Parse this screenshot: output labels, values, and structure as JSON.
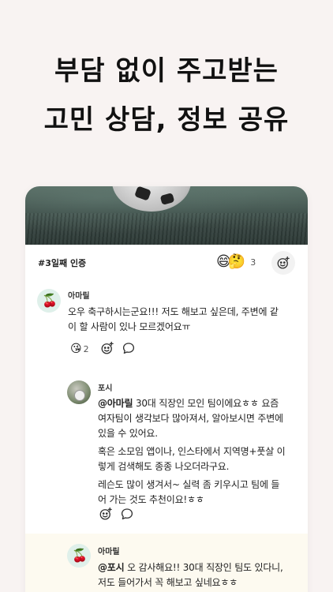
{
  "headline": {
    "line1": "부담 없이 주고받는",
    "line2": "고민 상담, 정보 공유"
  },
  "post": {
    "tag": "#3일째 인증",
    "reactions": {
      "emoji1": "😄",
      "emoji2": "🤔",
      "count": "3"
    }
  },
  "comments": [
    {
      "author": "아마릴",
      "avatar_emoji": "🍒",
      "lines": [
        "오우 축구하시는군요!!! 저도 해보고 싶은데, 주변에 같",
        "이 할 사람이 있나 모르겠어요ㅠ"
      ],
      "reaction": {
        "emoji": "😘",
        "count": "2"
      }
    },
    {
      "author": "포시",
      "mention": "@아마릴",
      "p1_first": " 30대 직장인 모인 팀이에요ㅎㅎ 요즘",
      "p1_lines": [
        "여자팀이 생각보다 많아져서, 알아보시면 주변에",
        "있을 수 있어요."
      ],
      "p2_lines": [
        "혹은 소모임 앱이나, 인스타에서 지역명+풋살 이",
        "렇게 검색해도 종종 나오더라구요."
      ],
      "p3_lines": [
        "레슨도 많이 생겨서~ 실력 좀 키우시고 팀에 들",
        "어 가는 것도 추천이요!ㅎㅎ"
      ]
    },
    {
      "author": "아마릴",
      "avatar_emoji": "🍒",
      "mention": "@포시",
      "first": " 오 감사해요!! 30대 직장인 팀도 있다니,",
      "second": "저도 들어가서 꼭 해보고 싶네요ㅎㅎ"
    }
  ],
  "colors": {
    "background": "#f8f3f2",
    "highlight": "#fdfaf0"
  },
  "icons": [
    "add-reaction-icon",
    "comment-icon"
  ]
}
